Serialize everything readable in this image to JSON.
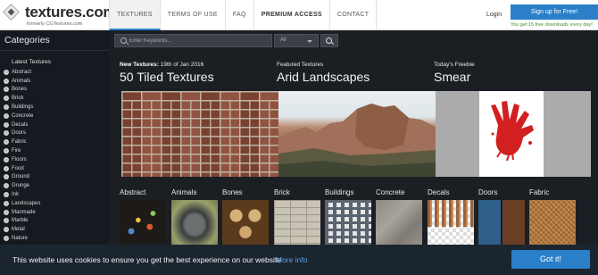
{
  "logo": {
    "text": "textures.com",
    "subtitle": "formerly CGTextures.com"
  },
  "nav": {
    "items": [
      "TEXTURES",
      "TERMS OF USE",
      "FAQ",
      "PREMIUM ACCESS",
      "CONTACT"
    ]
  },
  "account": {
    "login": "Login",
    "signup": "Sign up for Free!",
    "signup_note": "You get 15 free downloads every day!"
  },
  "sidebar": {
    "title": "Categories",
    "latest": "Latest Textures",
    "items": [
      "Abstract",
      "Animals",
      "Bones",
      "Brick",
      "Buildings",
      "Concrete",
      "Decals",
      "Doors",
      "Fabric",
      "Fire",
      "Floors",
      "Food",
      "Ground",
      "Grunge",
      "Ink",
      "Landscapes",
      "Manmade",
      "Marble",
      "Metal",
      "Nature"
    ]
  },
  "search": {
    "placeholder": "Enter Keywords...",
    "filter": "All"
  },
  "featured": [
    {
      "label": "New Textures:",
      "label_extra": " 19th of Jan 2016",
      "title": "50 Tiled Textures"
    },
    {
      "label": "Featured Textures",
      "label_extra": "",
      "title": "Arid Landscapes"
    },
    {
      "label": "Today's Freebie",
      "label_extra": "",
      "title": "Smear"
    }
  ],
  "tiles": [
    "Abstract",
    "Animals",
    "Bones",
    "Brick",
    "Buildings",
    "Concrete",
    "Decals",
    "Doors",
    "Fabric"
  ],
  "cookie": {
    "text": "This website uses cookies to ensure you get the best experience on our website",
    "link": "More info",
    "button": "Got it!"
  },
  "colors": {
    "accent": "#2a7fc8",
    "sidebar_bg": "#151a20",
    "main_bg": "#1b1f24",
    "cookie_bg": "#1b2530"
  }
}
